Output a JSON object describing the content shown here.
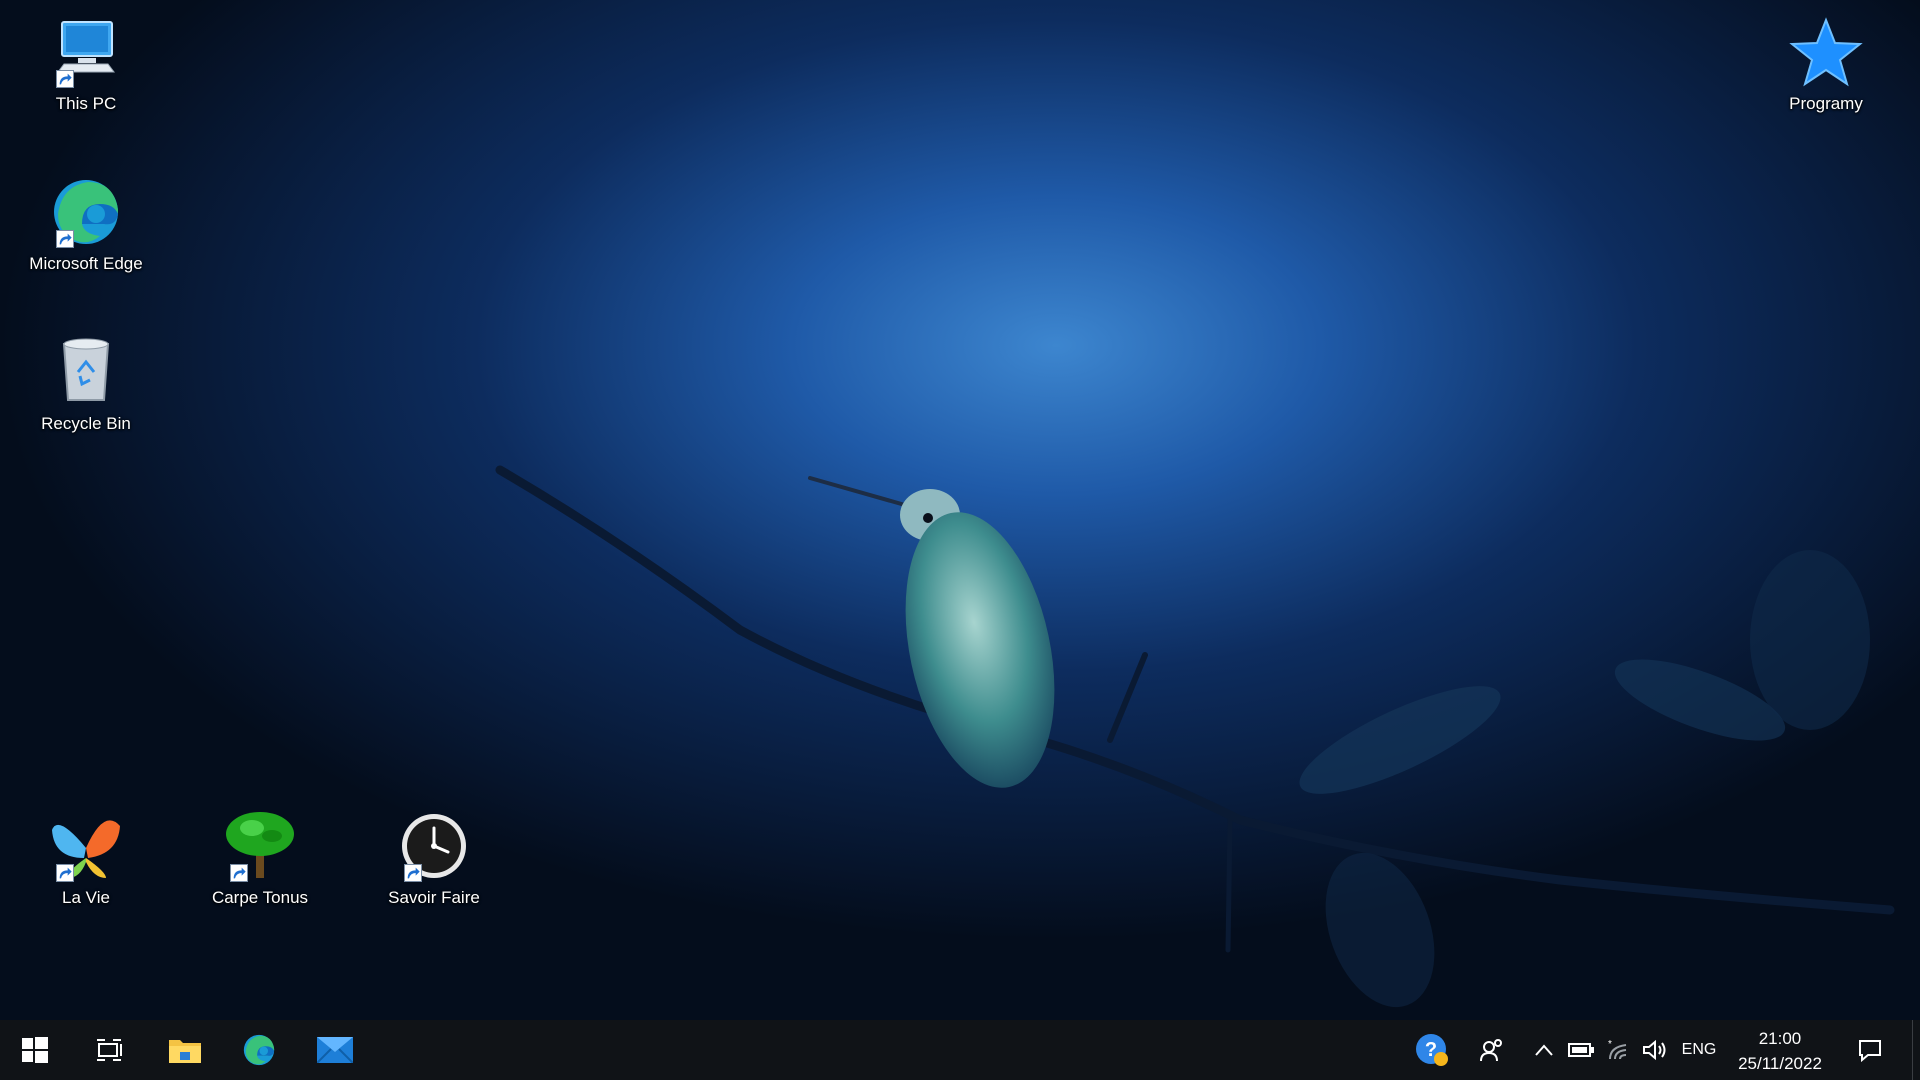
{
  "desktop": {
    "icons": [
      {
        "label": "This PC",
        "icon": "computer-icon"
      },
      {
        "label": "Microsoft Edge",
        "icon": "edge-icon"
      },
      {
        "label": "Recycle Bin",
        "icon": "recycle-bin-icon"
      },
      {
        "label": "La Vie",
        "icon": "butterfly-icon"
      },
      {
        "label": "Carpe Tonus",
        "icon": "tree-icon"
      },
      {
        "label": "Savoir Faire",
        "icon": "clock-icon"
      },
      {
        "label": "Programy",
        "icon": "star-icon"
      }
    ]
  },
  "taskbar": {
    "apps": [
      {
        "name": "start",
        "icon": "windows-logo-icon"
      },
      {
        "name": "task-view",
        "icon": "task-view-icon"
      },
      {
        "name": "file-explorer",
        "icon": "folder-icon"
      },
      {
        "name": "edge",
        "icon": "edge-icon"
      },
      {
        "name": "mail",
        "icon": "mail-icon"
      }
    ],
    "tray": {
      "language": "ENG",
      "time": "21:00",
      "date": "25/11/2022"
    }
  },
  "colors": {
    "taskbar_bg": "#101317",
    "accent_blue": "#1e90ff",
    "wallpaper_glow": "#2e6fc7"
  }
}
